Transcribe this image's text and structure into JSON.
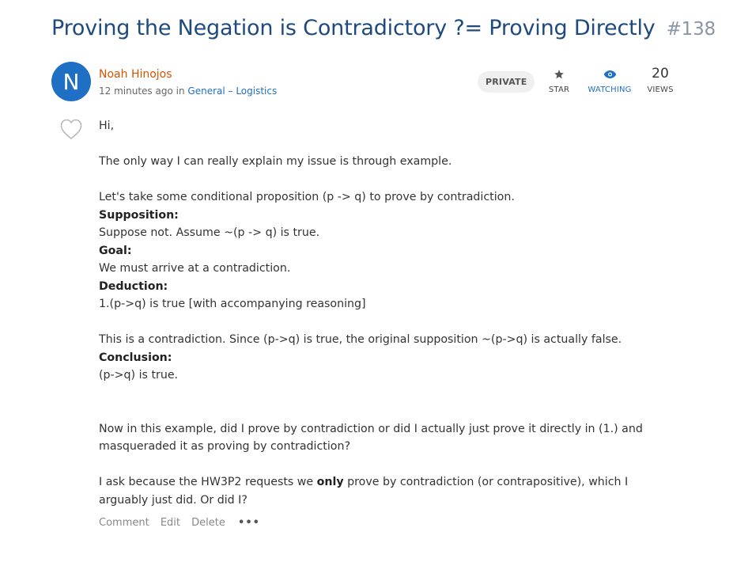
{
  "post": {
    "title": "Proving the Negation is Contradictory ?= Proving Directly",
    "number": "#138",
    "author": "Noah Hinojos",
    "avatar_letter": "N",
    "time": "12 minutes ago",
    "in_word": "in",
    "category": "General – Logistics",
    "badge": "PRIVATE"
  },
  "stats": {
    "star_label": "STAR",
    "watching_label": "WATCHING",
    "views_count": "20",
    "views_label": "VIEWS"
  },
  "content": {
    "greeting": "Hi,",
    "line1": "The only way I can really explain my issue is through example.",
    "line2": "Let's take some conditional proposition (p -> q) to prove by contradiction.",
    "supposition_label": "Supposition:",
    "supposition_text": "Suppose not. Assume ~(p -> q) is true.",
    "goal_label": "Goal:",
    "goal_text": "We must arrive at a contradiction.",
    "deduction_label": "Deduction:",
    "deduction_text": "1.(p->q) is true [with accompanying reasoning]",
    "contradiction_text": "This is a contradiction. Since (p->q) is true, the original supposition ~(p->q) is actually false.",
    "conclusion_label": "Conclusion:",
    "conclusion_text": "(p->q) is true.",
    "para_question": "Now in this example, did I prove by contradiction or did I actually just prove it directly in (1.) and masqueraded it as proving by contradiction?",
    "para_ask_before": "I ask because the HW3P2 requests we ",
    "para_ask_bold": "only",
    "para_ask_after": " prove by contradiction (or contrapositive), which I arguably just did. Or did I?"
  },
  "actions": {
    "comment": "Comment",
    "edit": "Edit",
    "delete": "Delete",
    "more": "•••"
  },
  "colors": {
    "title": "#1e4a7d",
    "accent": "#1f6fc5",
    "author": "#d35400",
    "badge_bg": "#f0f0f0"
  },
  "icons": {
    "star": "star-icon",
    "watch": "eye-icon",
    "like": "heart-icon",
    "more": "more-options-icon"
  }
}
